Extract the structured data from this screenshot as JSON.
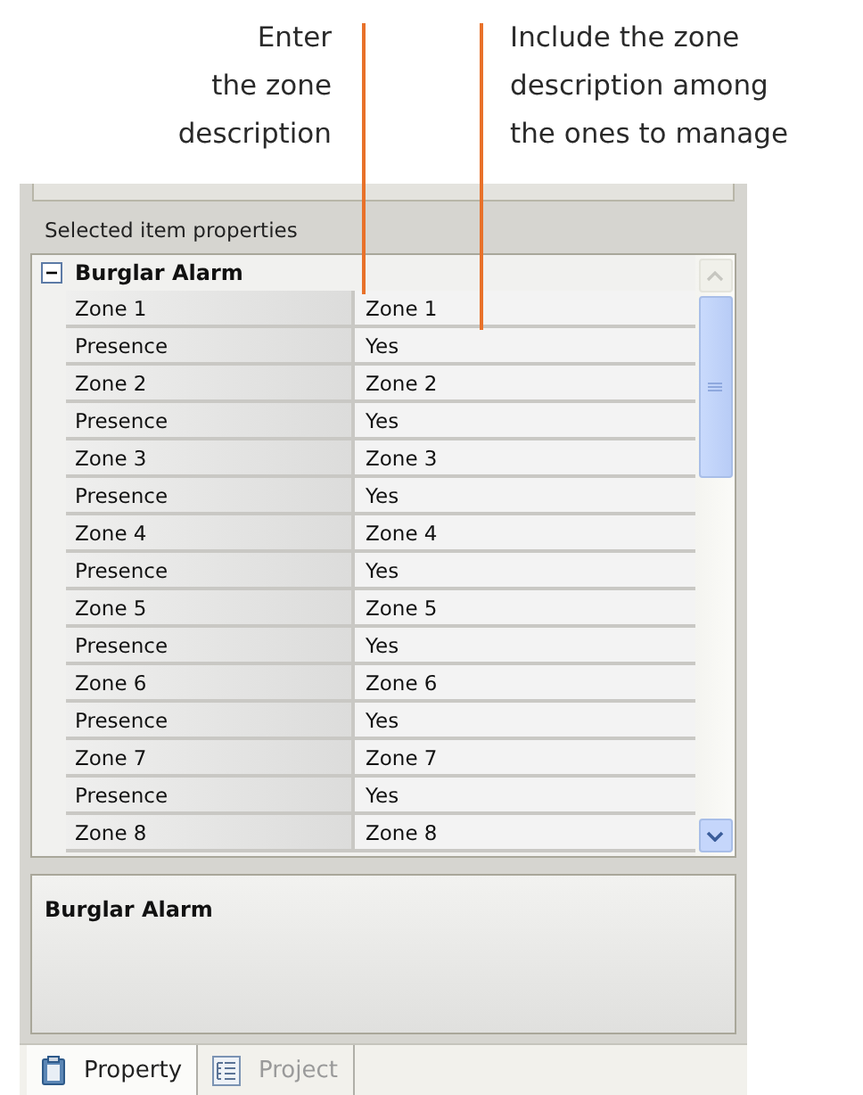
{
  "annotations": [
    {
      "lines": [
        "Enter",
        "the zone",
        "description"
      ]
    },
    {
      "lines": [
        "Include the zone",
        "description among",
        "the ones to manage"
      ]
    }
  ],
  "panel": {
    "title": "Selected item properties",
    "category": {
      "label": "Burglar Alarm",
      "expanded": true
    },
    "rows": [
      {
        "name": "Zone 1",
        "value": "Zone 1"
      },
      {
        "name": "Presence",
        "value": "Yes"
      },
      {
        "name": "Zone 2",
        "value": "Zone 2"
      },
      {
        "name": "Presence",
        "value": "Yes"
      },
      {
        "name": "Zone 3",
        "value": "Zone 3"
      },
      {
        "name": "Presence",
        "value": "Yes"
      },
      {
        "name": "Zone 4",
        "value": "Zone 4"
      },
      {
        "name": "Presence",
        "value": "Yes"
      },
      {
        "name": "Zone 5",
        "value": "Zone 5"
      },
      {
        "name": "Presence",
        "value": "Yes"
      },
      {
        "name": "Zone 6",
        "value": "Zone 6"
      },
      {
        "name": "Presence",
        "value": "Yes"
      },
      {
        "name": "Zone 7",
        "value": "Zone 7"
      },
      {
        "name": "Presence",
        "value": "Yes"
      },
      {
        "name": "Zone 8",
        "value": "Zone 8"
      }
    ],
    "description": "Burglar Alarm"
  },
  "tabs": [
    {
      "label": "Property",
      "selected": true
    },
    {
      "label": "Project",
      "selected": false
    }
  ]
}
